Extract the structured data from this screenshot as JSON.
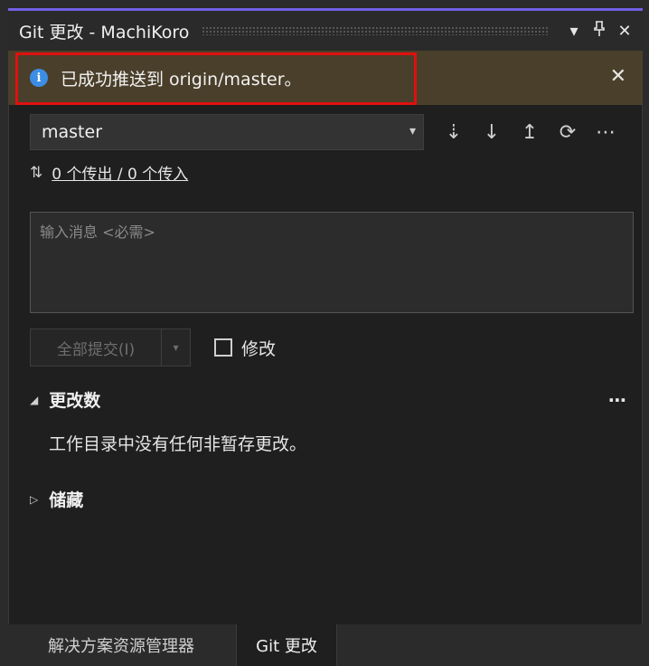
{
  "window": {
    "title": "Git 更改 - MachiKoro",
    "buttons": {
      "dropdown": "▾",
      "pin": "🖈",
      "close": "✕"
    }
  },
  "notification": {
    "icon": "info-icon",
    "text": "已成功推送到 origin/master。",
    "close": "✕"
  },
  "branch": {
    "name": "master",
    "dropdown_arrow": "▾",
    "actions": [
      {
        "icon": "fetch-icon",
        "glyph": "⇣"
      },
      {
        "icon": "pull-icon",
        "glyph": "↓"
      },
      {
        "icon": "push-icon",
        "glyph": "↥"
      },
      {
        "icon": "sync-icon",
        "glyph": "⟳"
      },
      {
        "icon": "more-icon",
        "glyph": "⋯"
      }
    ]
  },
  "sync_counts": {
    "arrows": "⇅",
    "text": "0 个传出 / 0 个传入"
  },
  "commit": {
    "message_placeholder": "输入消息 <必需>",
    "commit_all_label": "全部提交(I)",
    "split_arrow": "▾",
    "amend_label": "修改"
  },
  "changes": {
    "header": "更改数",
    "expanded_glyph": "◢",
    "more": "⋯",
    "empty_text": "工作目录中没有任何非暂存更改。"
  },
  "stashes": {
    "header": "储藏",
    "collapsed_glyph": "▷"
  },
  "tabs": [
    {
      "label": "解决方案资源管理器",
      "active": false
    },
    {
      "label": "Git 更改",
      "active": true
    }
  ],
  "colors": {
    "accent": "#7160e8",
    "info_banner": "#4a3f2a",
    "highlight_border": "#e01010",
    "info_icon": "#3c8de4"
  }
}
